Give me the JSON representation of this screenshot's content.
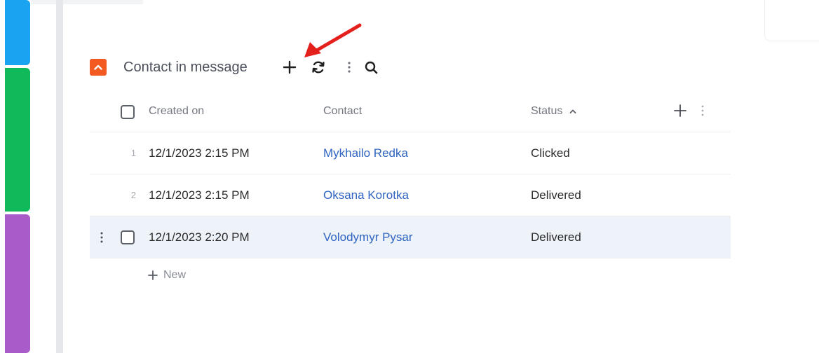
{
  "detail": {
    "title": "Contact in message",
    "columns": {
      "created_on": "Created on",
      "contact": "Contact",
      "status": "Status"
    },
    "rows": [
      {
        "num": "1",
        "created_on": "12/1/2023 2:15 PM",
        "contact": "Mykhailo Redka",
        "status": "Clicked"
      },
      {
        "num": "2",
        "created_on": "12/1/2023 2:15 PM",
        "contact": "Oksana Korotka",
        "status": "Delivered"
      },
      {
        "num": "",
        "created_on": "12/1/2023 2:20 PM",
        "contact": "Volodymyr Pysar",
        "status": "Delivered"
      }
    ],
    "new_label": "New"
  },
  "colors": {
    "accent_orange": "#f25a22",
    "link_blue": "#2f64c0",
    "annotation_arrow": "#e3201b",
    "strip_blue": "#1aa3f0",
    "strip_green": "#10b95a",
    "strip_purple": "#a95bc9"
  },
  "icons": [
    "chevron-up-icon",
    "plus-icon",
    "refresh-icon",
    "kebab-menu-icon",
    "search-icon",
    "sort-ascending-icon"
  ]
}
